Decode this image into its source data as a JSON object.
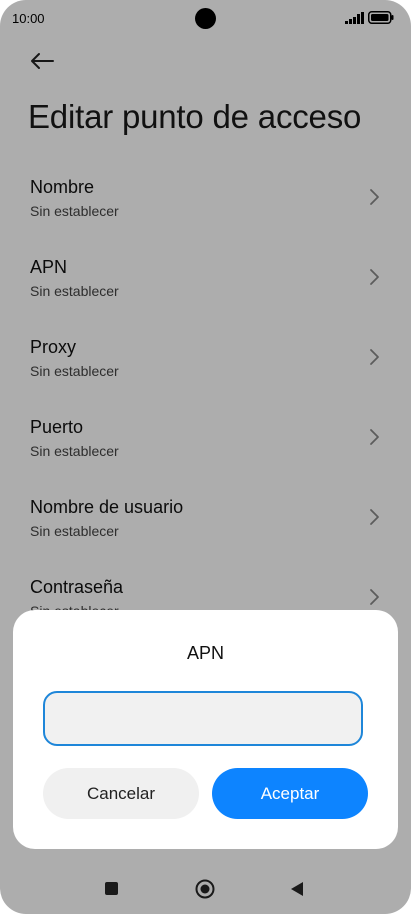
{
  "status_bar": {
    "time": "10:00",
    "icons": [
      "signal-icon",
      "battery-icon"
    ]
  },
  "header": {
    "back_icon": "arrow-left-icon",
    "title": "Editar punto de acceso"
  },
  "settings": {
    "items": [
      {
        "title": "Nombre",
        "subtitle": "Sin establecer"
      },
      {
        "title": "APN",
        "subtitle": "Sin establecer"
      },
      {
        "title": "Proxy",
        "subtitle": "Sin establecer"
      },
      {
        "title": "Puerto",
        "subtitle": "Sin establecer"
      },
      {
        "title": "Nombre de usuario",
        "subtitle": "Sin establecer"
      },
      {
        "title": "Contraseña",
        "subtitle": "Sin establecer"
      }
    ]
  },
  "dialog": {
    "title": "APN",
    "input_value": "",
    "cancel_label": "Cancelar",
    "accept_label": "Aceptar"
  },
  "nav_bar": {
    "icons": [
      "recents-square-icon",
      "home-circle-icon",
      "back-triangle-icon"
    ]
  },
  "colors": {
    "accent": "#0d84ff",
    "input_border": "#1e86d9",
    "overlay": "rgba(0,0,0,0.32)"
  }
}
